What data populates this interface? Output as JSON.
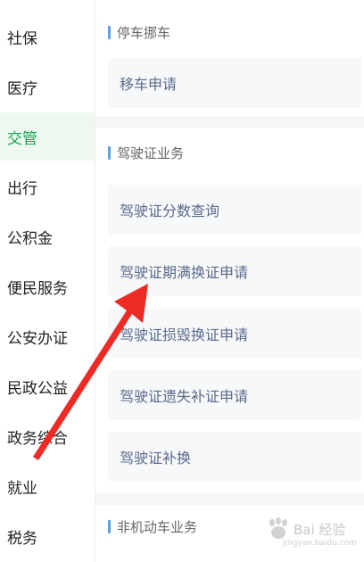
{
  "sidebar": {
    "items": [
      {
        "label": "社保"
      },
      {
        "label": "医疗"
      },
      {
        "label": "交管"
      },
      {
        "label": "出行"
      },
      {
        "label": "公积金"
      },
      {
        "label": "便民服务"
      },
      {
        "label": "公安办证"
      },
      {
        "label": "民政公益"
      },
      {
        "label": "政务综合"
      },
      {
        "label": "就业"
      },
      {
        "label": "税务"
      }
    ],
    "active_index": 2
  },
  "sections": [
    {
      "title": "停车挪车",
      "items": [
        "移车申请"
      ]
    },
    {
      "title": "驾驶证业务",
      "items": [
        "驾驶证分数查询",
        "驾驶证期满换证申请",
        "驾驶证损毁换证申请",
        "驾驶证遗失补证申请",
        "驾驶证补换"
      ]
    },
    {
      "title": "非机动车业务",
      "items": []
    }
  ],
  "watermark": {
    "text": "Bai 经验",
    "sub": "jingyan.baidu.com"
  },
  "colors": {
    "accent_green": "#15a84e",
    "section_bar": "#5aa0e6",
    "arrow": "#ee2a24"
  }
}
